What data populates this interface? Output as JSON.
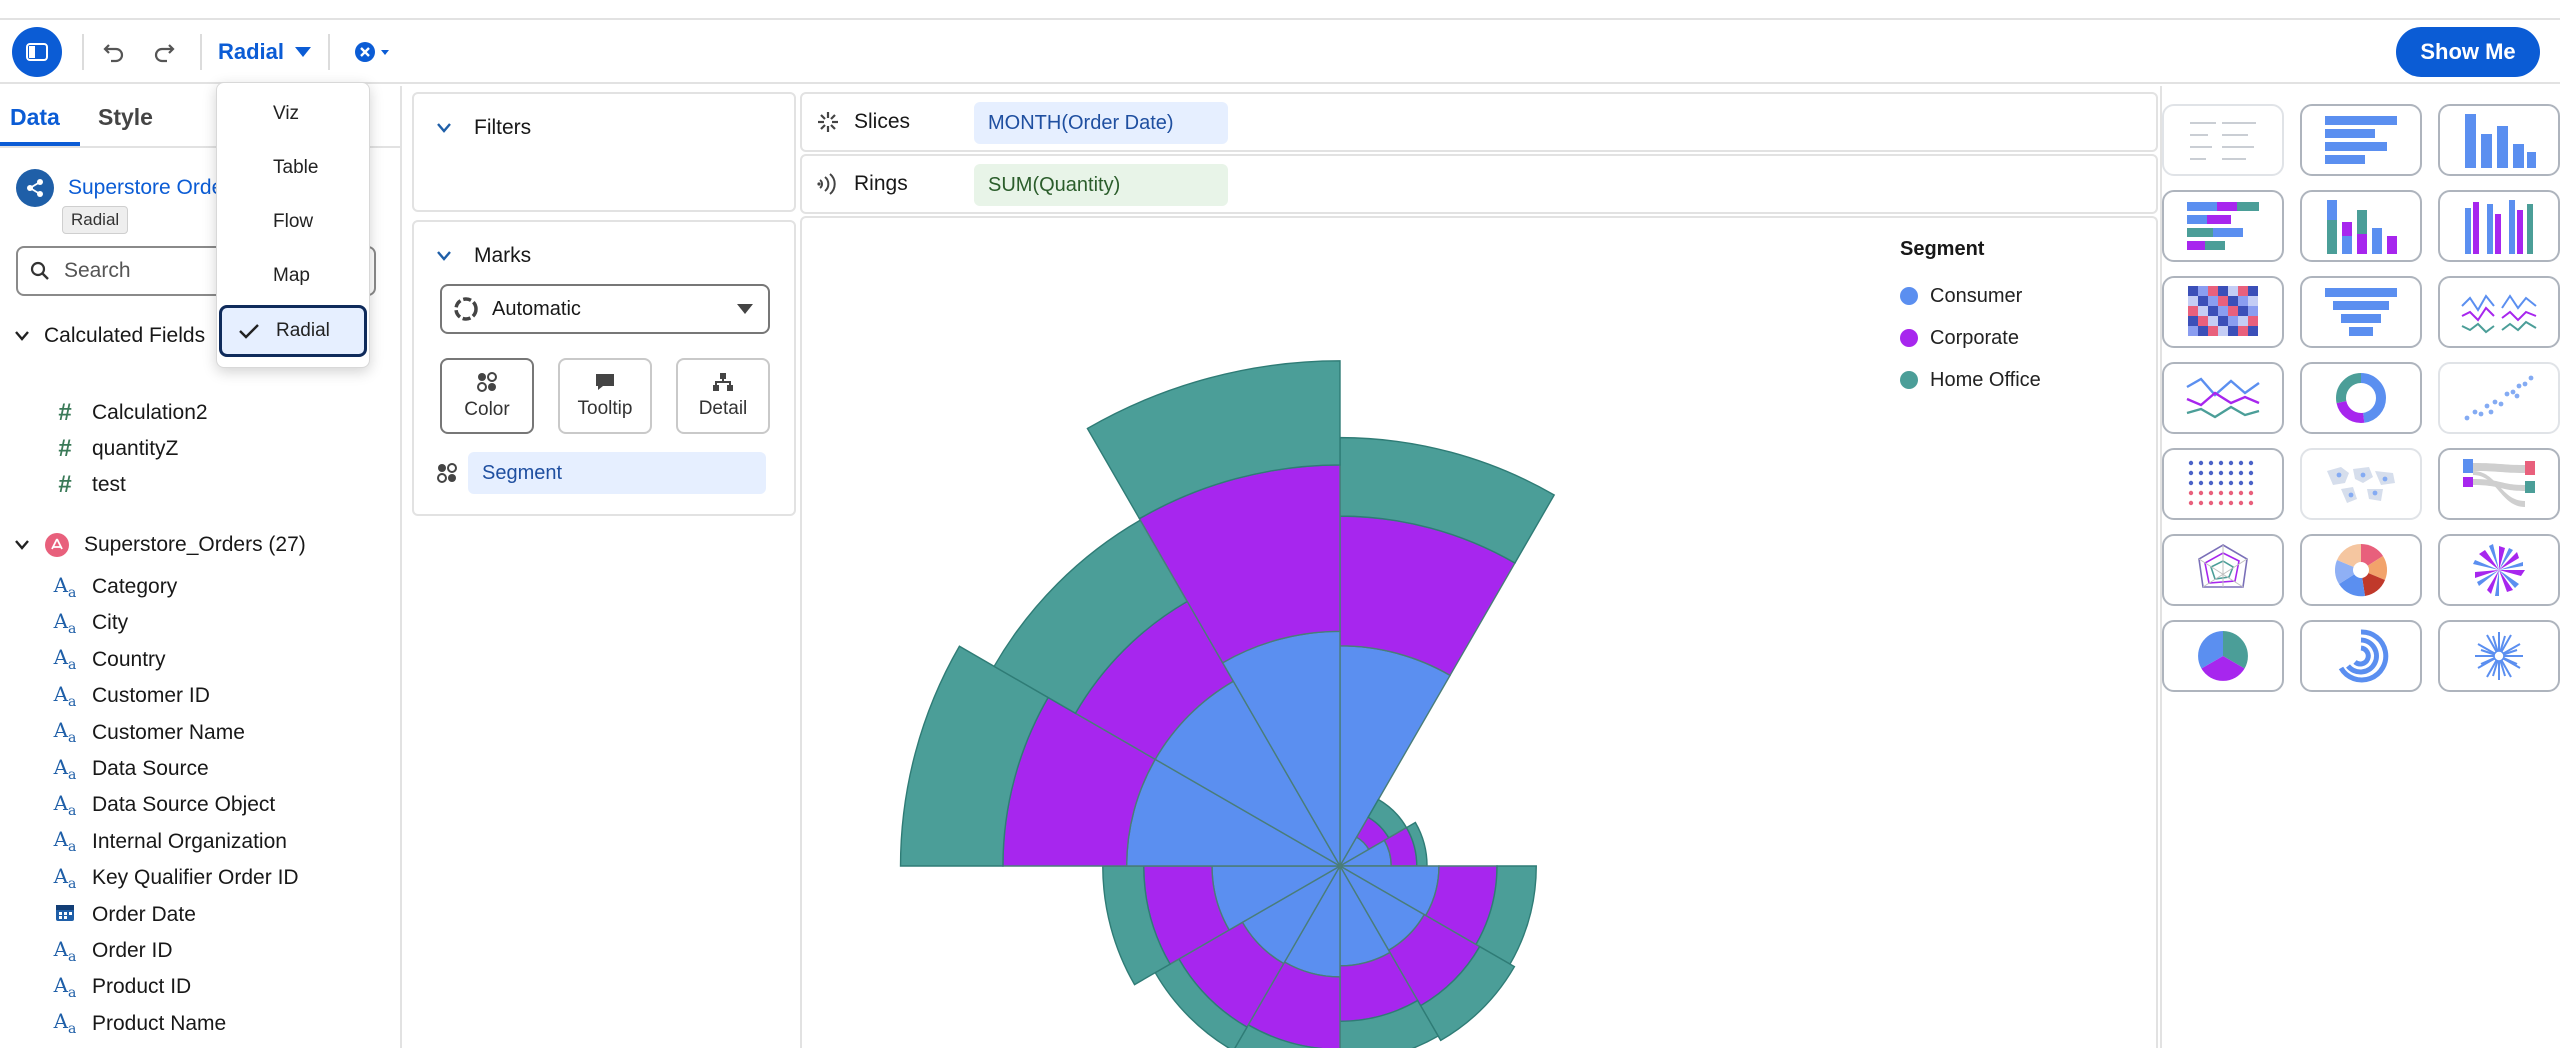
{
  "toolbar": {
    "viz_type": "Radial",
    "show_me_label": "Show Me"
  },
  "viz_menu": {
    "items": [
      "Viz",
      "Table",
      "Flow",
      "Map",
      "Radial"
    ],
    "selected": "Radial"
  },
  "data_pane": {
    "tabs": [
      "Data",
      "Style"
    ],
    "active_tab": "Data",
    "datasource_name": "Superstore Orde",
    "tooltip": "Radial",
    "search_placeholder": "Search",
    "calculated_fields": {
      "title": "Calculated Fields",
      "fields": [
        "Calculation2",
        "quantityZ",
        "test"
      ]
    },
    "orders": {
      "title": "Superstore_Orders (27)",
      "fields": [
        {
          "name": "Category",
          "type": "text"
        },
        {
          "name": "City",
          "type": "text"
        },
        {
          "name": "Country",
          "type": "text"
        },
        {
          "name": "Customer ID",
          "type": "text"
        },
        {
          "name": "Customer Name",
          "type": "text"
        },
        {
          "name": "Data Source",
          "type": "text"
        },
        {
          "name": "Data Source Object",
          "type": "text"
        },
        {
          "name": "Internal Organization",
          "type": "text"
        },
        {
          "name": "Key Qualifier Order ID",
          "type": "text"
        },
        {
          "name": "Order Date",
          "type": "date"
        },
        {
          "name": "Order ID",
          "type": "text"
        },
        {
          "name": "Product ID",
          "type": "text"
        },
        {
          "name": "Product Name",
          "type": "text"
        }
      ]
    }
  },
  "filters": {
    "title": "Filters"
  },
  "marks": {
    "title": "Marks",
    "mark_type": "Automatic",
    "buttons": [
      "Color",
      "Tooltip",
      "Detail"
    ],
    "color_field": "Segment"
  },
  "shelves": {
    "slices_label": "Slices",
    "slices_field": "MONTH(Order Date)",
    "rings_label": "Rings",
    "rings_field": "SUM(Quantity)"
  },
  "legend": {
    "title": "Segment",
    "items": [
      {
        "name": "Consumer",
        "color": "#5b8ff0"
      },
      {
        "name": "Corporate",
        "color": "#a726ee"
      },
      {
        "name": "Home Office",
        "color": "#4b9e98"
      }
    ]
  },
  "chart_data": {
    "type": "radial",
    "slice_field": "MONTH(Order Date)",
    "ring_field": "SUM(Quantity)",
    "series": [
      {
        "name": "Consumer",
        "color": "#5b8ff0"
      },
      {
        "name": "Corporate",
        "color": "#a726ee"
      },
      {
        "name": "Home Office",
        "color": "#4b9e98"
      }
    ],
    "slices": [
      {
        "consumer": 258,
        "corporate": 410,
        "home_office": 502
      },
      {
        "consumer": 39,
        "corporate": 66,
        "home_office": 90
      },
      {
        "consumer": 60,
        "corporate": 90,
        "home_office": 102
      },
      {
        "consumer": 116,
        "corporate": 184,
        "home_office": 230
      },
      {
        "consumer": 114,
        "corporate": 189,
        "home_office": 236
      },
      {
        "consumer": 117,
        "corporate": 182,
        "home_office": 230
      },
      {
        "consumer": 130,
        "corporate": 215,
        "home_office": 258
      },
      {
        "consumer": 132,
        "corporate": 218,
        "home_office": 250
      },
      {
        "consumer": 150,
        "corporate": 230,
        "home_office": 278
      },
      {
        "consumer": 250,
        "corporate": 395,
        "home_office": 515
      },
      {
        "consumer": 250,
        "corporate": 358,
        "home_office": 468
      },
      {
        "consumer": 275,
        "corporate": 470,
        "home_office": 592
      }
    ]
  }
}
